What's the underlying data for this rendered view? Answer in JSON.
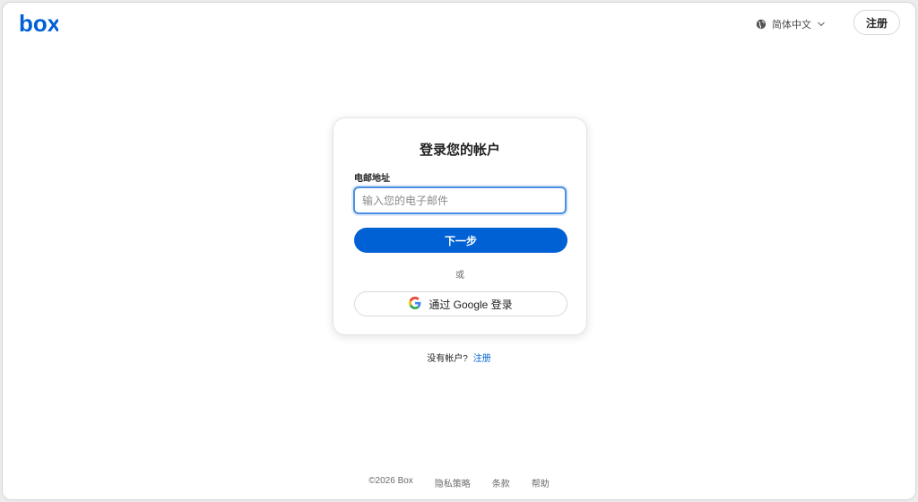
{
  "brand": {
    "logo_text": "box",
    "color": "#0061d5"
  },
  "header": {
    "language_label": "简体中文",
    "language_icon": "globe-icon",
    "dropdown_icon": "chevron-down-icon",
    "signup_label": "注册"
  },
  "login": {
    "title": "登录您的帐户",
    "email_label": "电邮地址",
    "email_placeholder": "输入您的电子邮件",
    "email_value": "",
    "next_label": "下一步",
    "or_text": "或",
    "google_label": "通过 Google 登录",
    "google_icon": "google-icon"
  },
  "signup_prompt": {
    "text": "没有帐户?",
    "link": "注册"
  },
  "footer": {
    "copyright": "©2026 Box",
    "privacy": "隐私策略",
    "terms": "条款",
    "help": "帮助"
  },
  "colors": {
    "accent": "#0061d5",
    "focus_border": "#4b8fe2",
    "background": "#ffffff"
  }
}
